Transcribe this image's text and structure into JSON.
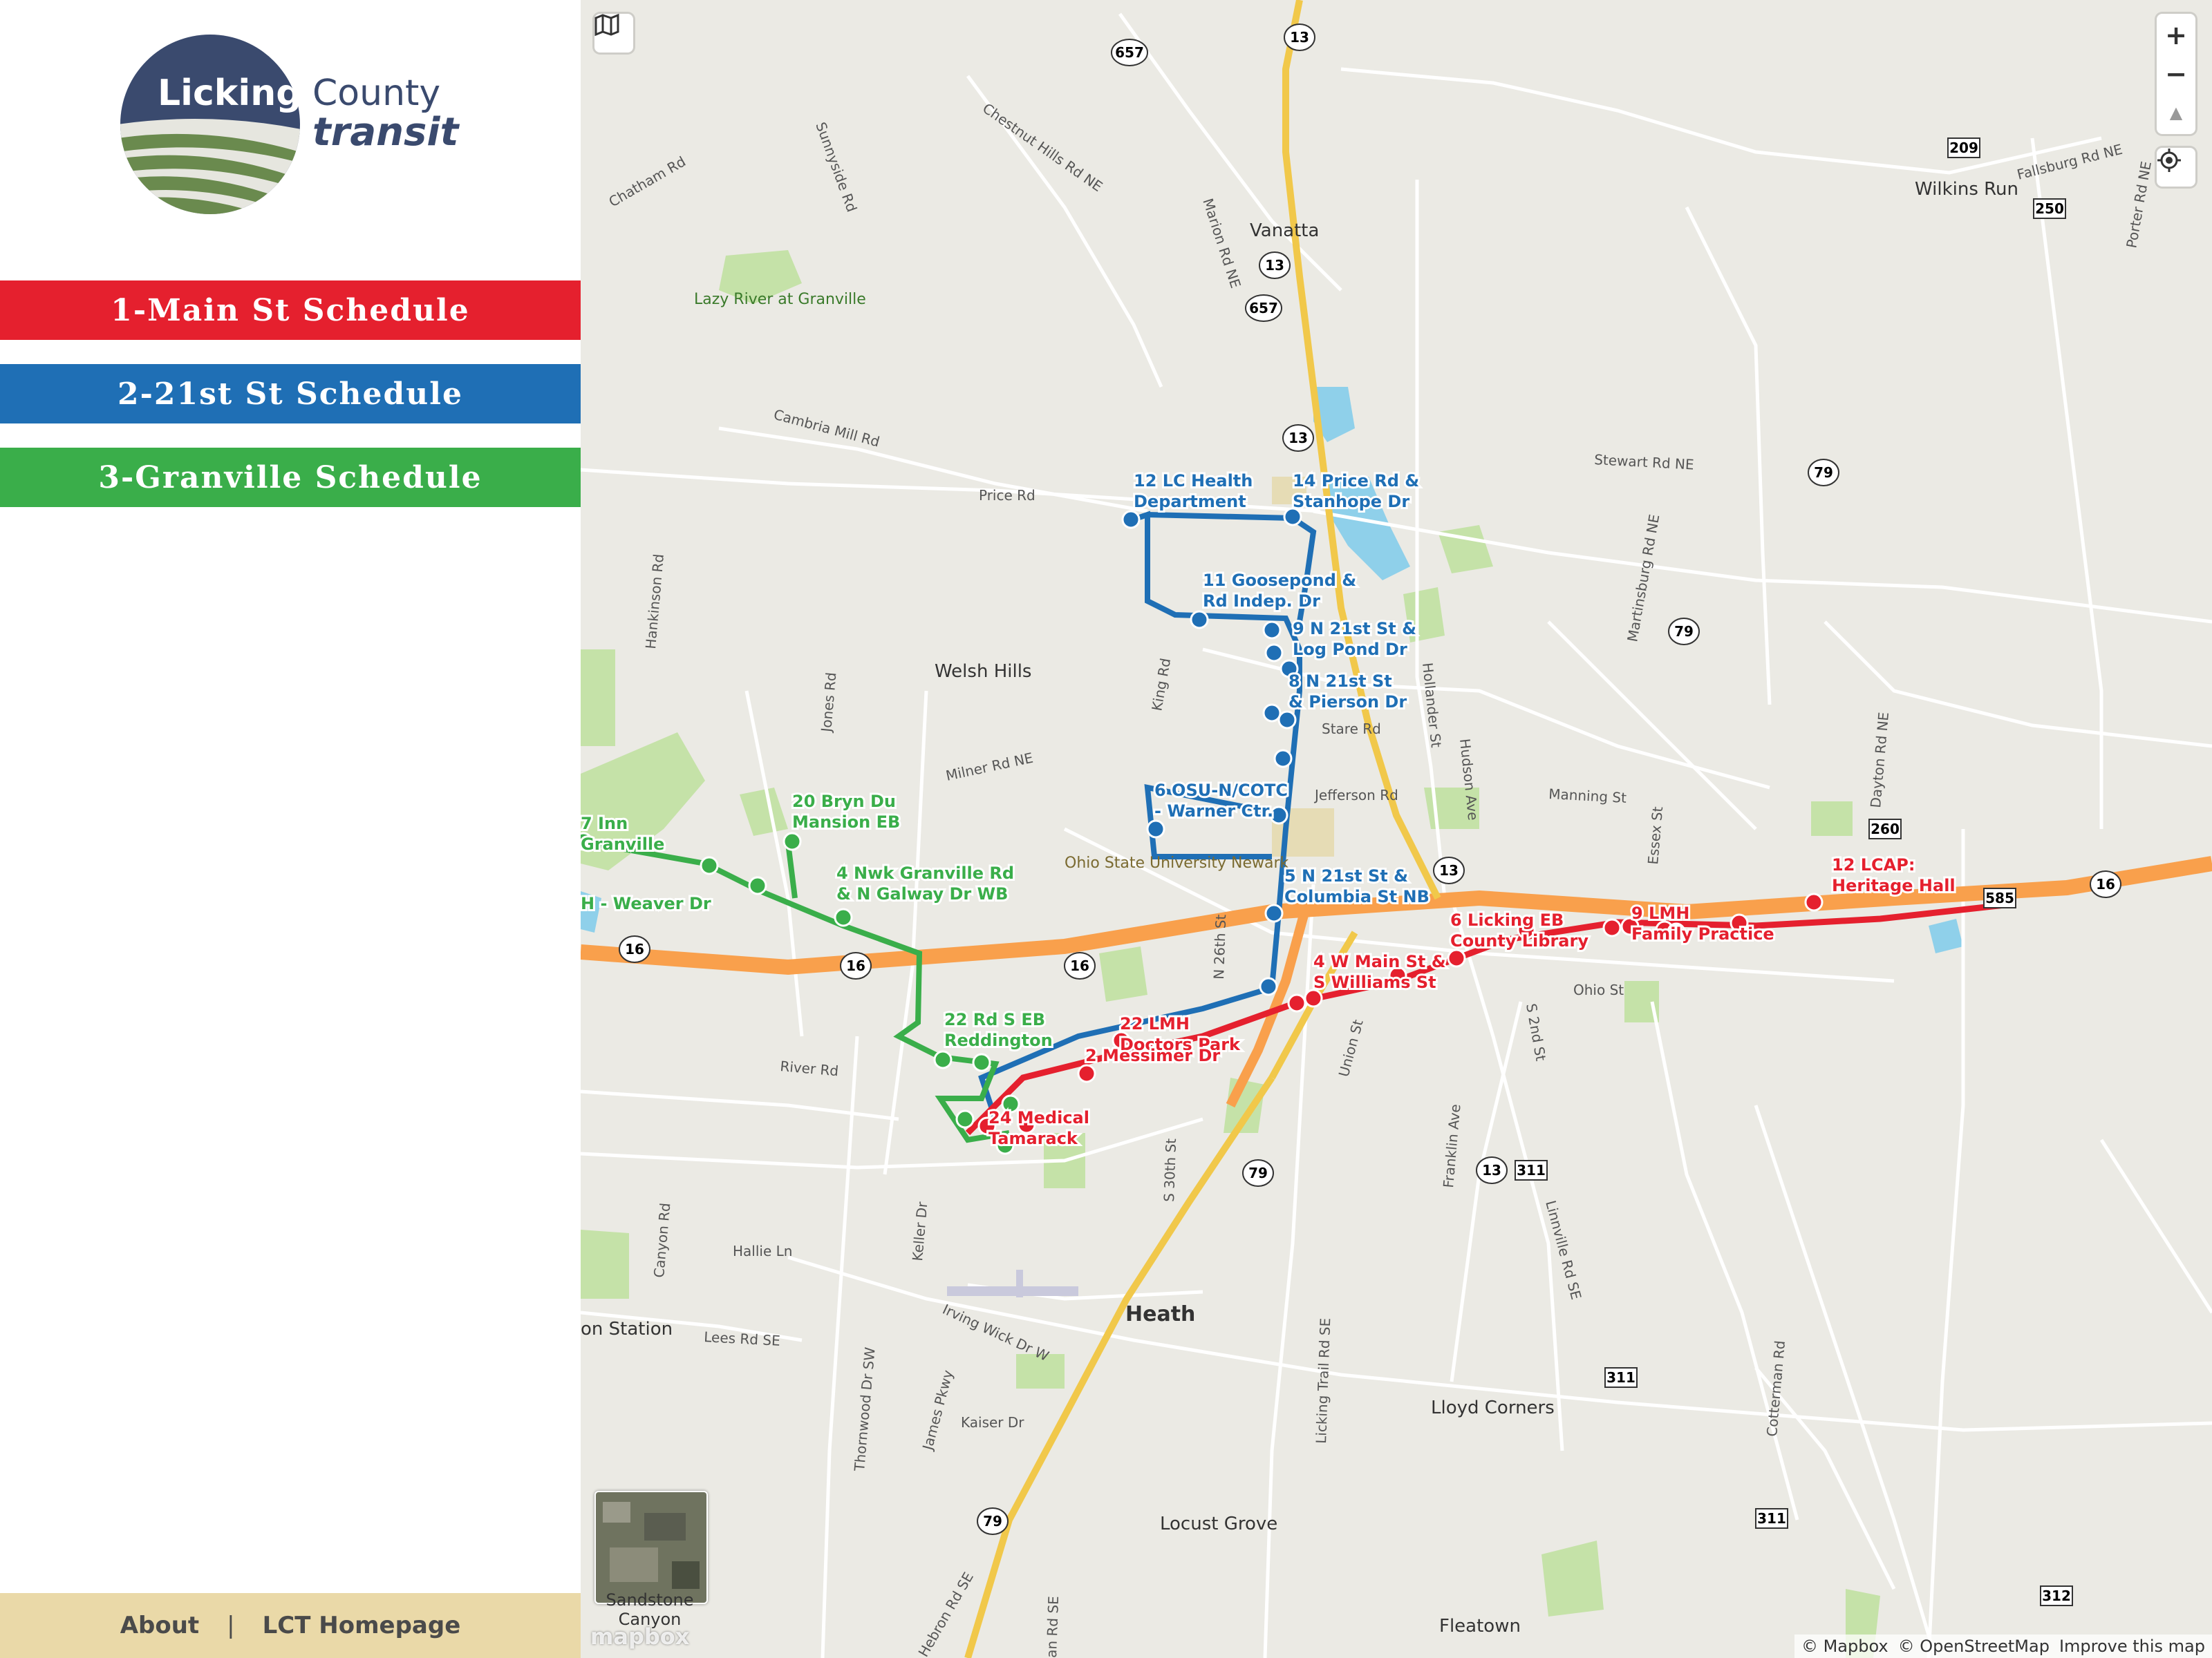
{
  "sidebar": {
    "logo": {
      "line1": "Licking",
      "line2": "County",
      "line3": "transit"
    },
    "schedules": [
      {
        "label": "1-Main St Schedule",
        "color": "#e5202e"
      },
      {
        "label": "2-21st St Schedule",
        "color": "#1f6fb5"
      },
      {
        "label": "3-Granville Schedule",
        "color": "#3aae4a"
      }
    ],
    "footer": {
      "about": "About",
      "separator": "|",
      "homepage": "LCT Homepage",
      "bg": "#ead9a8"
    }
  },
  "map": {
    "controls": {
      "zoom_in": "+",
      "zoom_out": "−",
      "compass": "▲",
      "geolocate": "⊙"
    },
    "attribution": {
      "mapbox": "© Mapbox",
      "osm": "© OpenStreetMap",
      "improve": "Improve this map"
    },
    "mapbox_logo": "mapbox",
    "minimap_label": "Sandstone Canyon",
    "places": [
      "Vanatta",
      "Wilkins Run",
      "Lazy River at Granville",
      "Welsh Hills",
      "Ohio State University Newark",
      "Heath",
      "Lloyd Corners",
      "Locust Grove",
      "Fleatown",
      "Sandstone Canyon",
      "on Station"
    ],
    "roads": [
      "Chestnut Hills Rd NE",
      "Sunnyside Rd",
      "Chatham Rd",
      "Marion Rd NE",
      "Fallsburg Rd NE",
      "Porter Rd NE",
      "Cambria Mill Rd",
      "Price Rd",
      "Stewart Rd NE",
      "Martinsburg Rd NE",
      "Hankinson Rd",
      "Jones Rd",
      "Milner Rd NE",
      "King Rd",
      "Hollander St",
      "Hudson Ave",
      "Stare Rd",
      "Jefferson Rd",
      "Manning St",
      "Essex St",
      "Dayton Rd NE",
      "N 26th St",
      "Ohio St",
      "S 2nd St",
      "River Rd",
      "Union St",
      "S 30th St",
      "Franklin Ave",
      "Linnville Rd SE",
      "Canyon Rd",
      "Hallie Ln",
      "Keller Dr",
      "Irving Wick Dr W",
      "Lees Rd SE",
      "Thornwood Dr SW",
      "James Pkwy",
      "Kaiser Dr",
      "Licking Trail Rd SE",
      "Cotterman Rd",
      "Hebron Rd SE",
      "an Rd SE"
    ],
    "shields": [
      "657",
      "13",
      "13",
      "657",
      "13",
      "209",
      "250",
      "79",
      "79",
      "260",
      "585",
      "16",
      "16",
      "16",
      "16",
      "13",
      "311",
      "79",
      "311",
      "311",
      "312",
      "79"
    ],
    "stops": {
      "blue": [
        "12 LC Health Department",
        "14 Price Rd & Stanhope Dr",
        "11 Goosepond Rd & Indep. Dr",
        "9 N 21st St & Log Pond Dr",
        "8 N 21st St & Pierson Dr",
        "6 OSU-N/COTC - Warner Ctr.",
        "5 N 21st St & Columbia St NB"
      ],
      "red": [
        "12 LCAP: Heritage Hall",
        "9 LMH Family Practice",
        "6 Licking County Library EB",
        "4 W Main St & S Williams St",
        "22 LMH Doctors Park",
        "2 Messimer Dr",
        "24 Tamarack Medical"
      ],
      "green": [
        "7 Granville Inn",
        "20 Bryn Du Mansion EB",
        "4 Nwk Granville Rd & N Galway Dr WB",
        "H - Weaver Dr",
        "22 Reddington Rd S EB"
      ]
    },
    "colors": {
      "land": "#ebeae4",
      "park": "#c5e2a8",
      "water": "#8fd0ea",
      "highway": "#f9a04c",
      "state_route": "#f1c84a",
      "road": "#ffffff",
      "route_red": "#e5202e",
      "route_blue": "#1f6fb5",
      "route_green": "#3aae4a"
    }
  }
}
